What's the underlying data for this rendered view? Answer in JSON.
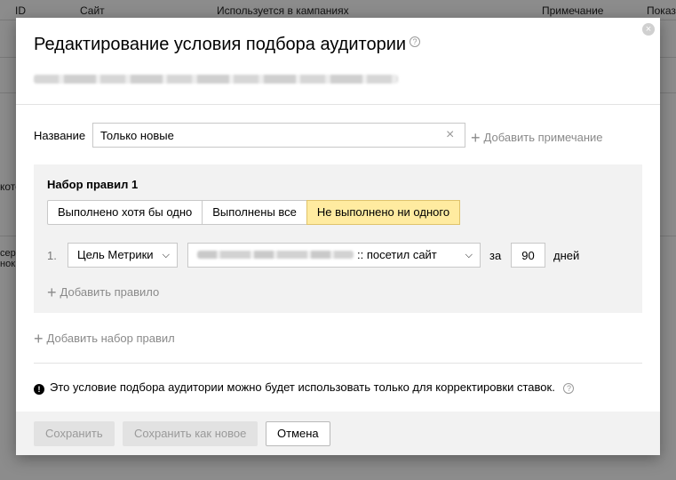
{
  "background": {
    "columns": [
      "ID",
      "Сайт",
      "Используется в кампаниях",
      "Примечание",
      "Показ"
    ],
    "snippets": [
      "кото",
      "серв",
      "нок"
    ]
  },
  "dialog": {
    "title": "Редактирование условия подбора аудитории",
    "help_icon": "?",
    "close_icon": "×"
  },
  "name_field": {
    "label": "Название",
    "value": "Только новые",
    "clear_icon": "×",
    "add_note": "Добавить примечание"
  },
  "ruleset": {
    "title": "Набор правил 1",
    "modes": [
      "Выполнено хотя бы одно",
      "Выполнены все",
      "Не выполнено ни одного"
    ],
    "active_mode": "Не выполнено ни одного",
    "rule": {
      "number": "1.",
      "type": "Цель Метрики",
      "goal_suffix": ":: посетил сайт",
      "za": "за",
      "days": "90",
      "days_label": "дней"
    },
    "add_rule": "Добавить правило"
  },
  "add_ruleset": "Добавить набор правил",
  "notice": {
    "icon": "!",
    "text": "Это условие подбора аудитории можно будет использовать только для корректировки ставок."
  },
  "footer": {
    "save": "Сохранить",
    "save_as_new": "Сохранить как новое",
    "cancel": "Отмена"
  },
  "colors": {
    "active_mode_bg": "#ffeba0",
    "panel_bg": "#f2f2f2",
    "muted_text": "#8a8a8a"
  }
}
